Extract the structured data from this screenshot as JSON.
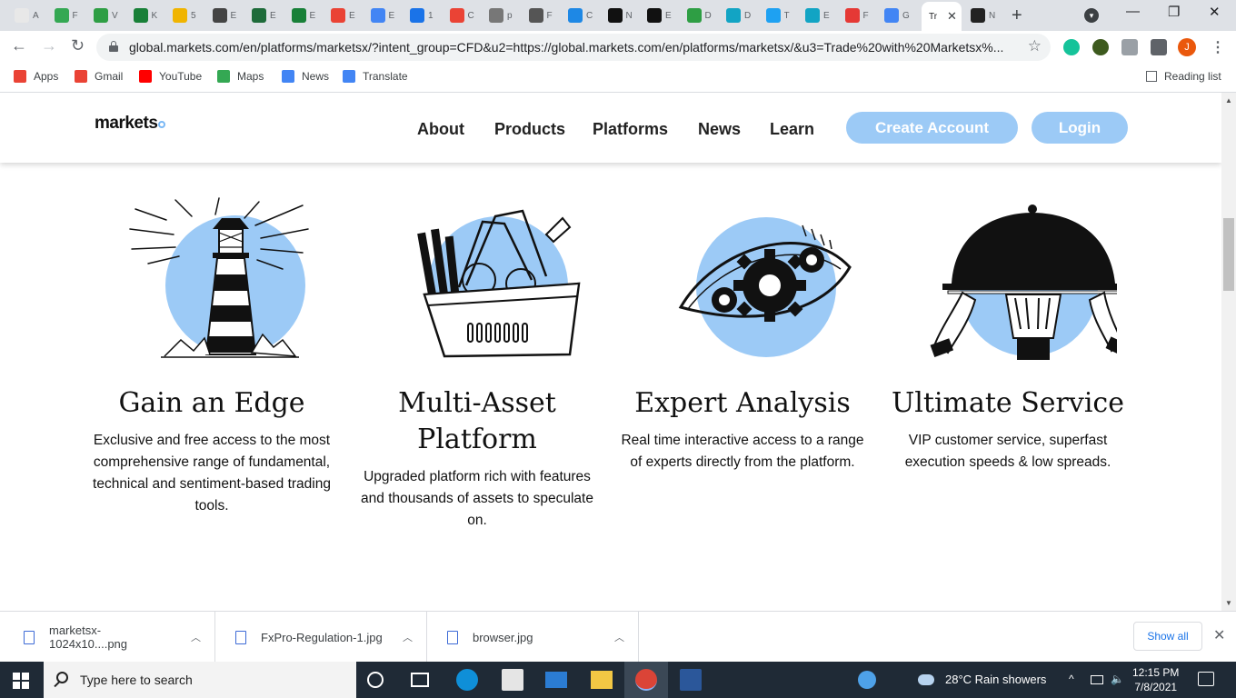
{
  "browser": {
    "active_tab_label": "Tr",
    "tabs": [
      {
        "label": "A",
        "color": "#e8e8e8"
      },
      {
        "label": "F",
        "color": "#34a853"
      },
      {
        "label": "V",
        "color": "#2e9e44"
      },
      {
        "label": "K",
        "color": "#188038"
      },
      {
        "label": "5",
        "color": "#f0b400"
      },
      {
        "label": "E",
        "color": "#444444"
      },
      {
        "label": "E",
        "color": "#1e6b3a"
      },
      {
        "label": "E",
        "color": "#188038"
      },
      {
        "label": "E",
        "color": "#ea4335"
      },
      {
        "label": "E",
        "color": "#4285f4"
      },
      {
        "label": "1",
        "color": "#1a73e8"
      },
      {
        "label": "C",
        "color": "#ea4335"
      },
      {
        "label": "p",
        "color": "#777777"
      },
      {
        "label": "F",
        "color": "#555555"
      },
      {
        "label": "C",
        "color": "#1e88e5"
      },
      {
        "label": "N",
        "color": "#111111"
      },
      {
        "label": "E",
        "color": "#111111"
      },
      {
        "label": "D",
        "color": "#2e9e44"
      },
      {
        "label": "D",
        "color": "#12a4c4"
      },
      {
        "label": "T",
        "color": "#1ea1f2"
      },
      {
        "label": "E",
        "color": "#12a4c4"
      },
      {
        "label": "F",
        "color": "#e53935"
      },
      {
        "label": "G",
        "color": "#4285f4"
      }
    ],
    "extra_tab_label": "N",
    "url": "global.markets.com/en/platforms/marketsx/?intent_group=CFD&u2=https://global.markets.com/en/platforms/marketsx/&u3=Trade%20with%20Marketsx%...",
    "profile_initial": "J",
    "bookmarks": [
      {
        "label": "Apps",
        "icon": "apps-grid-icon",
        "color": "#ea4335"
      },
      {
        "label": "Gmail",
        "icon": "gmail-icon",
        "color": "#ea4335"
      },
      {
        "label": "YouTube",
        "icon": "youtube-icon",
        "color": "#ff0000"
      },
      {
        "label": "Maps",
        "icon": "maps-icon",
        "color": "#34a853"
      },
      {
        "label": "News",
        "icon": "news-icon",
        "color": "#4285f4"
      },
      {
        "label": "Translate",
        "icon": "translate-icon",
        "color": "#4285f4"
      }
    ],
    "reading_list": "Reading list"
  },
  "site": {
    "logo": "markets",
    "nav": [
      "About",
      "Products",
      "Platforms",
      "News",
      "Learn"
    ],
    "create_account": "Create Account",
    "login": "Login",
    "accent": "#9ccaf6",
    "features": [
      {
        "title": "Gain an Edge",
        "description": "Exclusive and free access to the most comprehensive range of fundamental, technical and sentiment-based trading tools.",
        "icon": "lighthouse-icon"
      },
      {
        "title": "Multi-Asset Platform",
        "description": "Upgraded platform rich with features and thousands of assets to speculate on.",
        "icon": "basket-icon"
      },
      {
        "title": "Expert Analysis",
        "description": "Real time interactive access to a range of experts directly from the platform.",
        "icon": "eye-gears-icon"
      },
      {
        "title": "Ultimate Service",
        "description": "VIP customer service, superfast execution speeds & low spreads.",
        "icon": "serving-cloche-icon"
      }
    ]
  },
  "downloads": {
    "items": [
      "marketsx-1024x10....png",
      "FxPro-Regulation-1.jpg",
      "browser.jpg"
    ],
    "show_all": "Show all"
  },
  "taskbar": {
    "search_placeholder": "Type here to search",
    "weather": "28°C  Rain showers",
    "time": "12:15 PM",
    "date": "7/8/2021"
  }
}
